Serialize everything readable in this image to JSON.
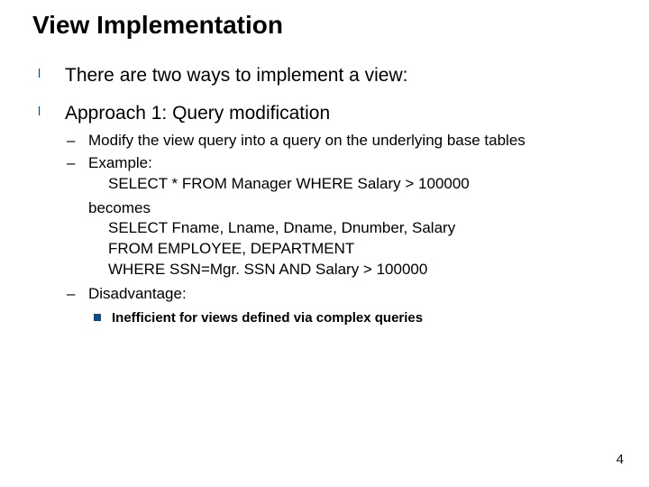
{
  "title": "View Implementation",
  "bullets": {
    "b1": "There are two ways to implement a view:",
    "b2": "Approach 1: Query modification"
  },
  "sub": {
    "s1": "Modify the view query into a query on the underlying base tables",
    "s2a": "Example:",
    "s2b": "SELECT * FROM Manager WHERE Salary > 100000",
    "becomes": "becomes",
    "s2c": "SELECT Fname, Lname, Dname, Dnumber, Salary",
    "s2d": "FROM EMPLOYEE, DEPARTMENT",
    "s2e": "WHERE SSN=Mgr. SSN AND Salary > 100000",
    "s3": "Disadvantage:"
  },
  "subsub": {
    "d1": "Inefficient for views defined via complex queries"
  },
  "page": "4"
}
